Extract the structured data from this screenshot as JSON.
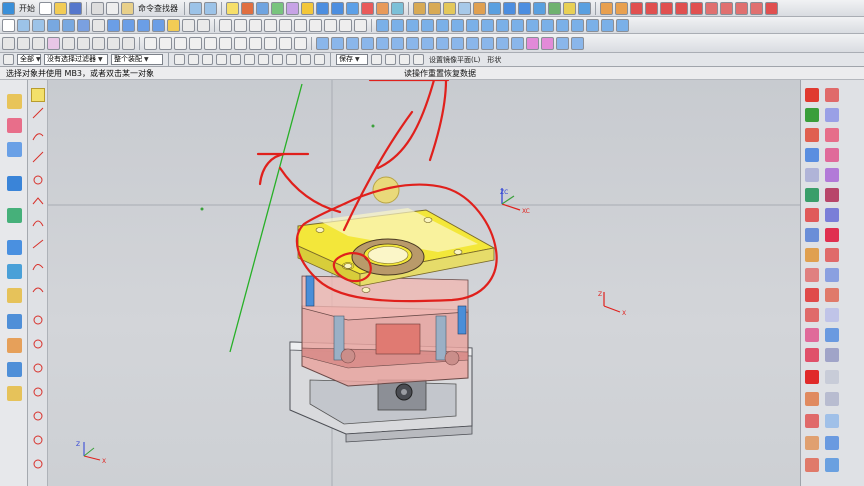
{
  "menubar": {
    "start_label": "开始",
    "command_finder_label": "命令查找器"
  },
  "selectbar": {
    "filter_value": "全部",
    "filter_placeholder": "没有选择过滤器",
    "assembly_value": "整个装配",
    "save_label": "保存",
    "wcs_label": "设置镜像平面(L)",
    "shape_label": "形状"
  },
  "cue": {
    "left_text": "选择对象并使用 MB3，或者双击某一对象",
    "mid_text": "读操作重置恢复数据"
  },
  "colors": {
    "annotation_red": "#e0201c",
    "csys_blue": "#2b3fd6",
    "mold_yellow": "#f3e73a",
    "mold_pink": "#e8a5a0"
  },
  "icons": {
    "resource": [
      "assembly-navigator-icon",
      "constraint-navigator-icon",
      "part-navigator-icon",
      "reuse-library-icon",
      "history-icon",
      "web-browser-icon",
      "process-studio-icon",
      "roles-icon",
      "system-materials-icon",
      "palette-icon"
    ],
    "right": [
      "mold-wizard-icon",
      "part-family-icon",
      "mold-csys-icon",
      "shrinkage-icon",
      "workpiece-icon",
      "layout-icon"
    ]
  }
}
